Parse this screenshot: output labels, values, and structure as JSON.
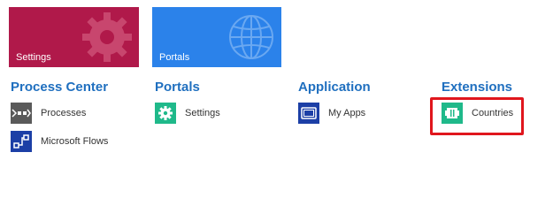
{
  "tiles": [
    {
      "label": "Settings",
      "icon": "gear-icon",
      "color": "#b0194a"
    },
    {
      "label": "Portals",
      "icon": "globe-icon",
      "color": "#2b82ea"
    }
  ],
  "sections": {
    "process_center": {
      "heading": "Process Center",
      "items": [
        {
          "label": "Processes",
          "icon": "process-icon",
          "color": "#5a5a5a"
        },
        {
          "label": "Microsoft Flows",
          "icon": "flow-icon",
          "color": "#1c3fa6"
        }
      ]
    },
    "portals": {
      "heading": "Portals",
      "items": [
        {
          "label": "Settings",
          "icon": "gear-icon",
          "color": "#1fb98a"
        }
      ]
    },
    "application": {
      "heading": "Application",
      "items": [
        {
          "label": "My Apps",
          "icon": "apps-icon",
          "color": "#1c3fa6"
        }
      ]
    },
    "extensions": {
      "heading": "Extensions",
      "items": [
        {
          "label": "Countries",
          "icon": "extension-icon",
          "color": "#1fb98a"
        }
      ]
    }
  },
  "colors": {
    "heading": "#1f6fbf",
    "highlight_border": "#e0161d"
  }
}
